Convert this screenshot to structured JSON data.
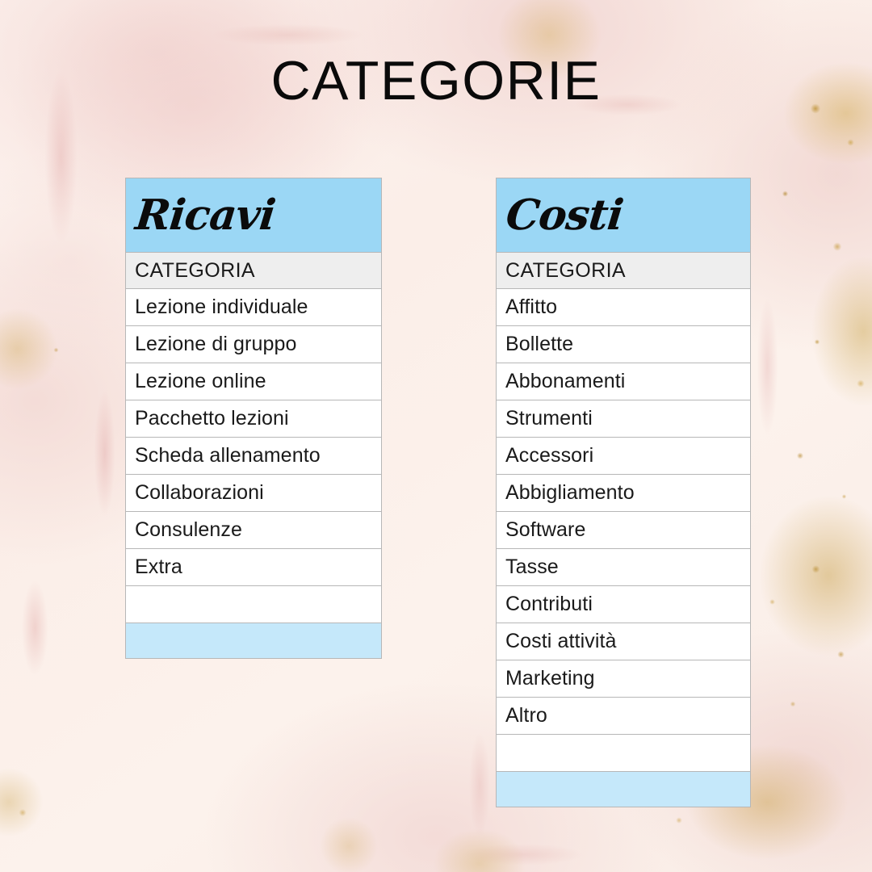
{
  "page": {
    "title": "CATEGORIE",
    "background_color": "#fbf1ec",
    "accent_color": "#9bd7f5",
    "footer_color": "#c5e8fa",
    "subhead_color": "#eeeeee",
    "grid_color": "#b7b7b7"
  },
  "tables": [
    {
      "id": "ricavi",
      "header": "Ricavi",
      "column_header": "CATEGORIA",
      "rows": [
        "Lezione individuale",
        "Lezione di gruppo",
        "Lezione online",
        "Pacchetto lezioni",
        "Scheda allenamento",
        "Collaborazioni",
        "Consulenze",
        "Extra",
        ""
      ]
    },
    {
      "id": "costi",
      "header": "Costi",
      "column_header": "CATEGORIA",
      "rows": [
        "Affitto",
        "Bollette",
        "Abbonamenti",
        "Strumenti",
        "Accessori",
        "Abbigliamento",
        "Software",
        "Tasse",
        "Contributi",
        "Costi attività",
        "Marketing",
        "Altro",
        ""
      ]
    }
  ]
}
